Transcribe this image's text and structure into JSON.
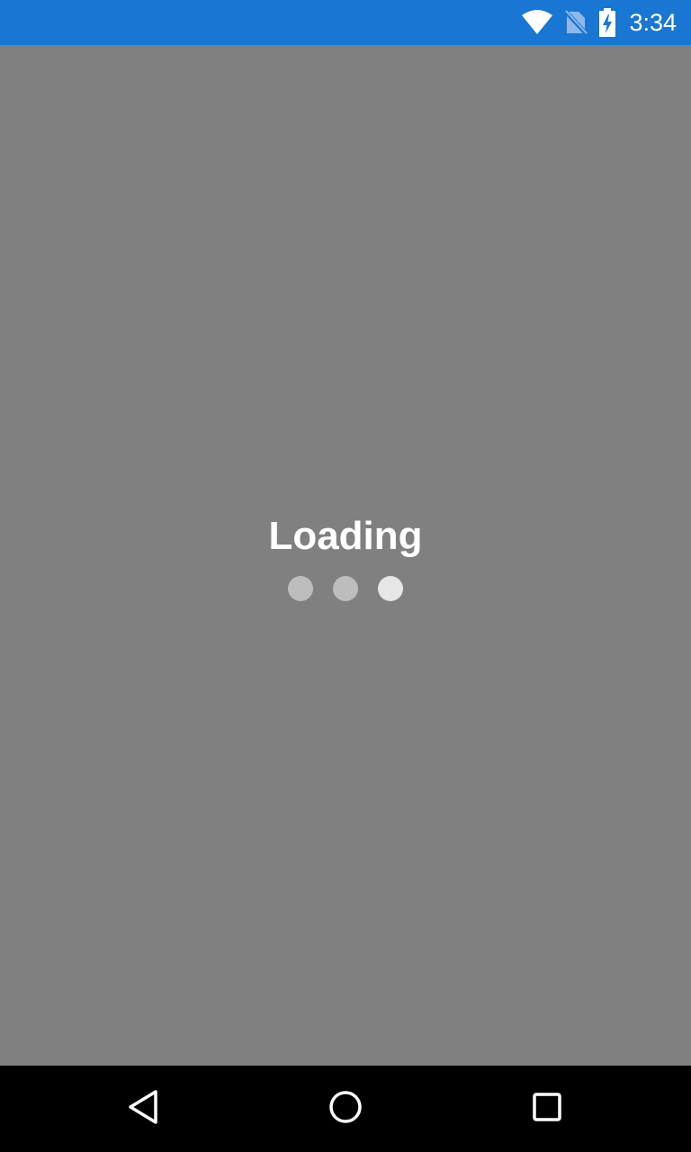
{
  "status_bar": {
    "time": "3:34",
    "background_color": "#1976D2",
    "icons": [
      "wifi-icon",
      "no-sim-icon",
      "battery-charging-icon"
    ]
  },
  "main": {
    "background_color": "#808080",
    "loading_label": "Loading",
    "dots": [
      {
        "state": "inactive"
      },
      {
        "state": "inactive"
      },
      {
        "state": "active"
      }
    ]
  },
  "nav_bar": {
    "buttons": [
      "back-icon",
      "home-icon",
      "recents-icon"
    ]
  }
}
